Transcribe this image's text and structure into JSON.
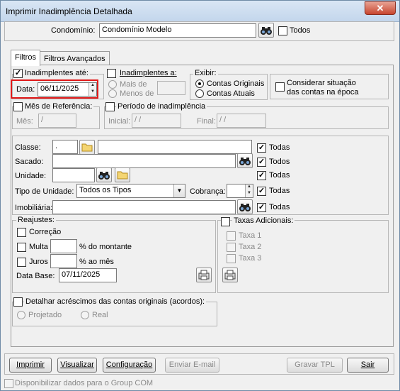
{
  "window": {
    "title": "Imprimir Inadimplência Detalhada",
    "close_icon": "close-icon"
  },
  "header": {
    "condominio_label": "Condomínio:",
    "condominio_value": "Condomínio Modelo",
    "todos_label": "Todos",
    "todos_checked": false
  },
  "tabs": [
    {
      "label": "Filtros",
      "active": true
    },
    {
      "label": "Filtros Avançados",
      "active": false
    }
  ],
  "inadimplentes_ate": {
    "label": "Inadimplentes até:",
    "checked": true,
    "data_label": "Data:",
    "data_value": "06/11/2025"
  },
  "inadimplentes_a": {
    "label": "Inadimplentes a:",
    "checked": false,
    "mais_de": "Mais de",
    "menos_de": "Menos de"
  },
  "exibir": {
    "label": "Exibir:",
    "options": [
      "Contas Originais",
      "Contas Atuais"
    ],
    "selected": "Contas Originais"
  },
  "considerar": {
    "label_line1": "Considerar situação",
    "label_line2": "das contas na época",
    "checked": false
  },
  "mes_referencia": {
    "label": "Mês de Referência:",
    "checked": false,
    "mes_label": "Mês:",
    "mes_value": "  /"
  },
  "periodo": {
    "label": "Período de inadimplência",
    "checked": false,
    "inicial_label": "Inicial:",
    "inicial_value": " / /",
    "final_label": "Final:",
    "final_value": " / /"
  },
  "filtros": {
    "classe_label": "Classe:",
    "classe_code": ".",
    "sacado_label": "Sacado:",
    "unidade_label": "Unidade:",
    "tipo_unidade_label": "Tipo de Unidade:",
    "tipo_unidade_value": "Todos os Tipos",
    "cobranca_label": "Cobrança:",
    "imobiliaria_label": "Imobiliária:",
    "todas_label": "Todas",
    "todos_label": "Todos"
  },
  "reajustes": {
    "label": "Reajustes:",
    "correcao": "Correção",
    "multa": "Multa",
    "multa_suffix": "% do montante",
    "juros": "Juros",
    "juros_suffix": "% ao mês",
    "data_base_label": "Data Base:",
    "data_base_value": "07/11/2025"
  },
  "taxas": {
    "label": "Taxas Adicionais:",
    "items": [
      "Taxa 1",
      "Taxa 2",
      "Taxa 3"
    ]
  },
  "acrescimos": {
    "label": "Detalhar acréscimos das contas originais (acordos):",
    "options": [
      "Projetado",
      "Real"
    ]
  },
  "buttons": {
    "imprimir": "Imprimir",
    "visualizar": "Visualizar",
    "configuracao": "Configuração",
    "enviar_email": "Enviar E-mail",
    "gravar_tpl": "Gravar TPL",
    "sair": "Sair"
  },
  "footer": {
    "group_com_label": "Disponibilizar dados para o Group COM"
  },
  "icons": {
    "search": "binoculars-icon",
    "folder": "folder-icon",
    "config": "config-icon"
  }
}
